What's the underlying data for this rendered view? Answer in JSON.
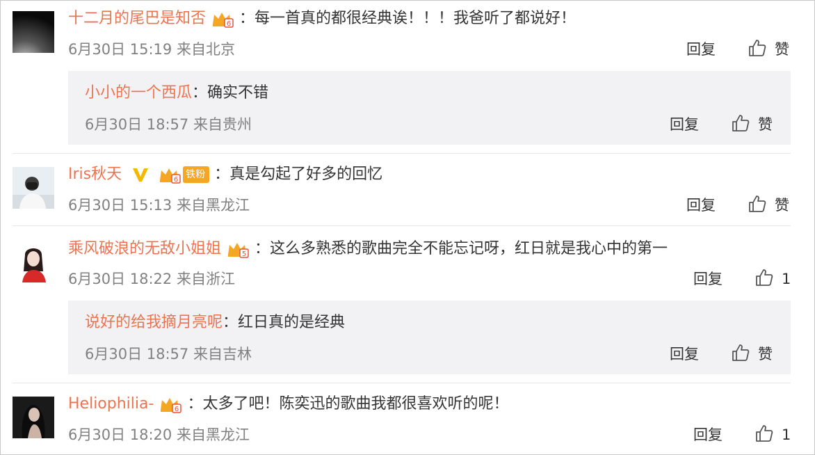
{
  "comments": [
    {
      "username": "十二月的尾巴是知否",
      "text": "：每一首真的都很经典诶！！！我爸听了都说好！",
      "time": "6月30日 15:19 来自北京",
      "reply_label": "回复",
      "like_label": "赞",
      "reply": {
        "username": "小小的一个西瓜",
        "text": "：确实不错",
        "time": "6月30日 18:57 来自贵州",
        "reply_label": "回复",
        "like_label": "赞"
      }
    },
    {
      "username": "Iris秋天",
      "fan_badge": "铁粉",
      "text": "：真是勾起了好多的回忆",
      "time": "6月30日 15:13 来自黑龙江",
      "reply_label": "回复",
      "like_label": "赞"
    },
    {
      "username": "乘风破浪的无敌小姐姐",
      "text": "：这么多熟悉的歌曲完全不能忘记呀，红日就是我心中的第一",
      "time": "6月30日 18:22 来自浙江",
      "reply_label": "回复",
      "like_label": "1",
      "reply": {
        "username": "说好的给我摘月亮呢",
        "text": "：红日真的是经典",
        "time": "6月30日 18:57 来自吉林",
        "reply_label": "回复",
        "like_label": "赞"
      }
    },
    {
      "username": "Heliophilia-",
      "text": "：太多了吧！陈奕迅的歌曲我都很喜欢听的呢！",
      "time": "6月30日 18:20 来自黑龙江",
      "reply_label": "回复",
      "like_label": "1"
    }
  ],
  "colors": {
    "username": "#eb7350",
    "meta": "#808080",
    "reply_bg": "#f2f2f5",
    "vip_badge": "#f5a623",
    "verified_v": "#f5b800"
  },
  "icons": [
    "vip-badge-icon",
    "verified-v-icon",
    "thumbs-up-icon"
  ]
}
